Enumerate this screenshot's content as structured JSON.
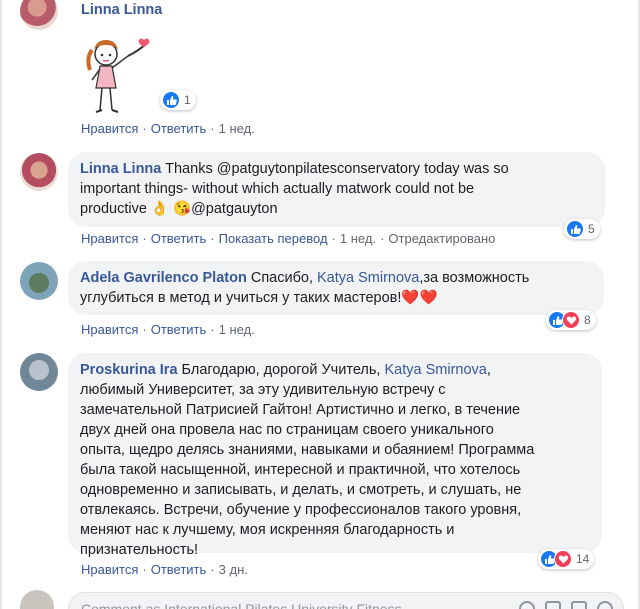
{
  "comments": [
    {
      "author": "Linna Linna",
      "reactions": "1",
      "actions": {
        "like": "Нравится",
        "reply": "Ответить",
        "time": "1 нед."
      }
    },
    {
      "author": "Linna Linna",
      "text_1": "Thanks @patguytonpilatesconservatory today was so",
      "text_2": "important things- without which actually matwork could not be",
      "text_3": "productive 👌 😘@patgauyton",
      "reactions": "5",
      "actions": {
        "like": "Нравится",
        "reply": "Ответить",
        "translate": "Показать перевод",
        "time": "1 нед.",
        "edited": "Отредактировано"
      }
    },
    {
      "author": "Adela Gavrilenco Platon",
      "text_a": " Спасибо, ",
      "mention": "Katya Smirnova",
      "text_b": ",за возможность",
      "text_2": "углубиться в метод и учиться у таких мастеров!❤️❤️",
      "reactions": "8",
      "actions": {
        "like": "Нравится",
        "reply": "Ответить",
        "time": "1 нед."
      }
    },
    {
      "author": "Proskurina Ira",
      "text_a": " Благодарю, дорогой Учитель, ",
      "mention": "Katya Smirnova",
      "text_b": ",",
      "lines": [
        "любимый Университет, за эту удивительную встречу с",
        "замечательной Патрисией Гайтон! Артистично и легко, в течение",
        "двух дней она провела нас по страницам своего уникального",
        "опыта, щедро делясь знаниями, навыками и обаянием! Программа",
        "была такой насыщенной, интересной и практичной, что хотелось",
        "одновременно и записывать, и делать, и смотреть, и слушать, не",
        "отвлекаясь. Встречи, обучение у профессионалов такого уровня,",
        "меняют нас к лучшему, моя искренняя благодарность и",
        "признательность!"
      ],
      "reactions": "14",
      "actions": {
        "like": "Нравится",
        "reply": "Ответить",
        "time": "3 дн."
      }
    }
  ],
  "composer": {
    "placeholder": "Comment as International Pilates University Fitness..."
  },
  "colors": {
    "link": "#385898",
    "bubble": "#f2f3f5",
    "like": "#1877f2",
    "love": "#f33e58"
  }
}
